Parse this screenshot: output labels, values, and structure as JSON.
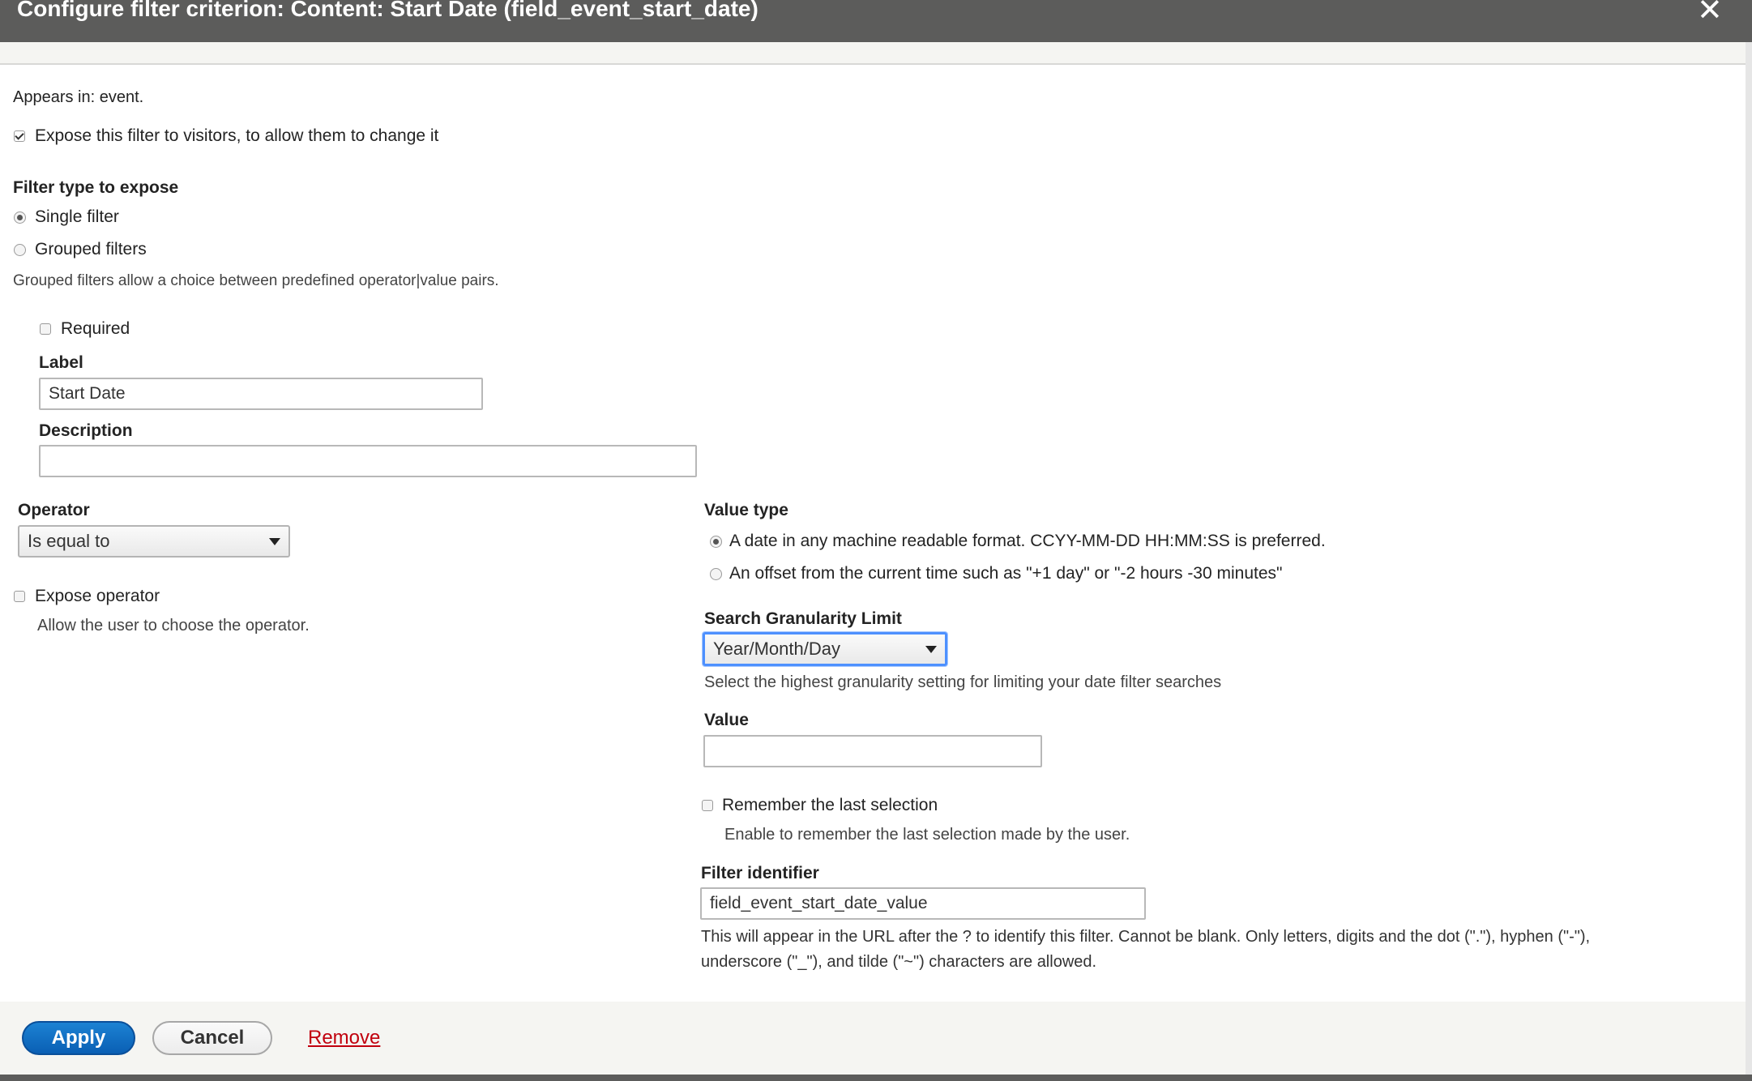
{
  "dialog": {
    "title": "Configure filter criterion: Content: Start Date (field_event_start_date)",
    "close_glyph": "✕"
  },
  "appears_in": "Appears in: event.",
  "expose": {
    "label": "Expose this filter to visitors, to allow them to change it",
    "checked": true
  },
  "filter_type": {
    "heading": "Filter type to expose",
    "options": [
      {
        "label": "Single filter",
        "checked": true
      },
      {
        "label": "Grouped filters",
        "checked": false
      }
    ],
    "help": "Grouped filters allow a choice between predefined operator|value pairs."
  },
  "required": {
    "label": "Required",
    "checked": false
  },
  "label_field": {
    "label": "Label",
    "value": "Start Date"
  },
  "description_field": {
    "label": "Description",
    "value": ""
  },
  "operator": {
    "label": "Operator",
    "selected": "Is equal to",
    "expose_label": "Expose operator",
    "expose_help": "Allow the user to choose the operator."
  },
  "value_type": {
    "label": "Value type",
    "options": [
      {
        "label": "A date in any machine readable format. CCYY-MM-DD HH:MM:SS is preferred.",
        "checked": true
      },
      {
        "label": "An offset from the current time such as \"+1 day\" or \"-2 hours -30 minutes\"",
        "checked": false
      }
    ]
  },
  "granularity": {
    "label": "Search Granularity Limit",
    "selected": "Year/Month/Day",
    "help": "Select the highest granularity setting for limiting your date filter searches"
  },
  "value_field": {
    "label": "Value",
    "value": ""
  },
  "remember": {
    "label": "Remember the last selection",
    "help": "Enable to remember the last selection made by the user.",
    "checked": false
  },
  "identifier": {
    "label": "Filter identifier",
    "value": "field_event_start_date_value",
    "help_line1": "This will appear in the URL after the ? to identify this filter. Cannot be blank. Only letters, digits and the dot (\".\"), hyphen (\"-\"),",
    "help_line2": "underscore (\"_\"), and tilde (\"~\") characters are allowed."
  },
  "actions": {
    "apply": "Apply",
    "cancel": "Cancel",
    "remove": "Remove"
  },
  "colors": {
    "accent": "#0a5fb4",
    "titlebar": "#5c5c5b",
    "danger_link": "#c1000d",
    "focus": "#4d90fe"
  }
}
